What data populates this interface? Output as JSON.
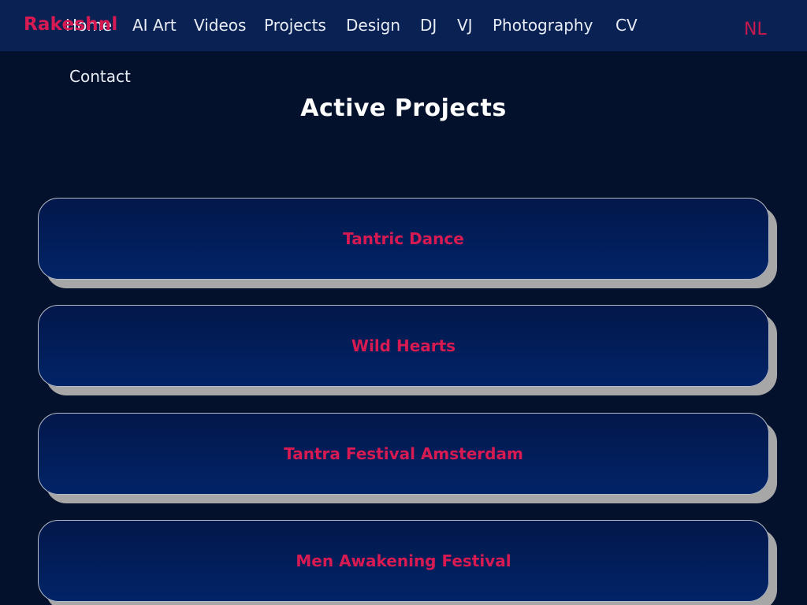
{
  "brand": {
    "name": "Rakeshnl",
    "color": "#d81a52"
  },
  "nav": {
    "items": [
      {
        "label": "Home"
      },
      {
        "label": "AI Art"
      },
      {
        "label": "Videos"
      },
      {
        "label": "Projects"
      },
      {
        "label": "Design"
      },
      {
        "label": "DJ"
      },
      {
        "label": "VJ"
      },
      {
        "label": "Photography"
      },
      {
        "label": "CV"
      },
      {
        "label": "Contact"
      }
    ]
  },
  "language": {
    "label": "NL"
  },
  "page": {
    "title": "Active Projects"
  },
  "projects": [
    {
      "title": "Tantric Dance"
    },
    {
      "title": "Wild Hearts"
    },
    {
      "title": "Tantra Festival Amsterdam"
    },
    {
      "title": "Men Awakening Festival"
    }
  ],
  "colors": {
    "background": "#03112c",
    "header": "#0a2154",
    "accent": "#d81a52",
    "card_border": "#b6bcc8",
    "card_shadow": "#a7a7a7"
  }
}
